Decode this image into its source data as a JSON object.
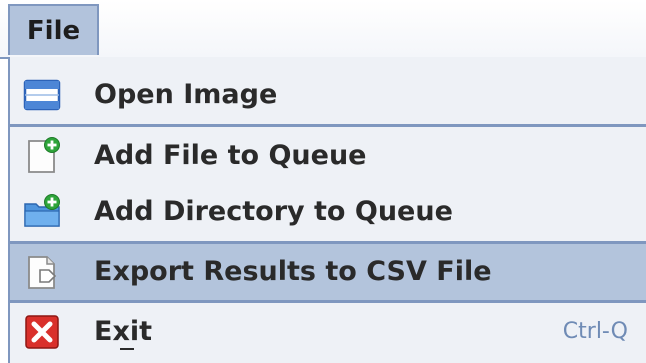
{
  "menubar": {
    "file_label": "File"
  },
  "menu": {
    "open_image": {
      "label": "Open Image",
      "icon": "open-image-icon"
    },
    "add_file": {
      "label": "Add File to Queue",
      "icon": "add-file-icon"
    },
    "add_directory": {
      "label": "Add Directory to Queue",
      "icon": "add-directory-icon"
    },
    "export_csv": {
      "label": "Export Results to CSV File",
      "icon": "export-csv-icon",
      "state": "highlighted"
    },
    "exit": {
      "label": "Exit",
      "mnemonic": "x",
      "shortcut": "Ctrl-Q",
      "icon": "exit-icon"
    }
  },
  "colors": {
    "menubar_selected": "#b2c3dc",
    "menu_background": "#eef1f6",
    "highlight": "#b3c4dc",
    "separator": "#7f97bf",
    "shortcut_text": "#6f8bb5"
  }
}
